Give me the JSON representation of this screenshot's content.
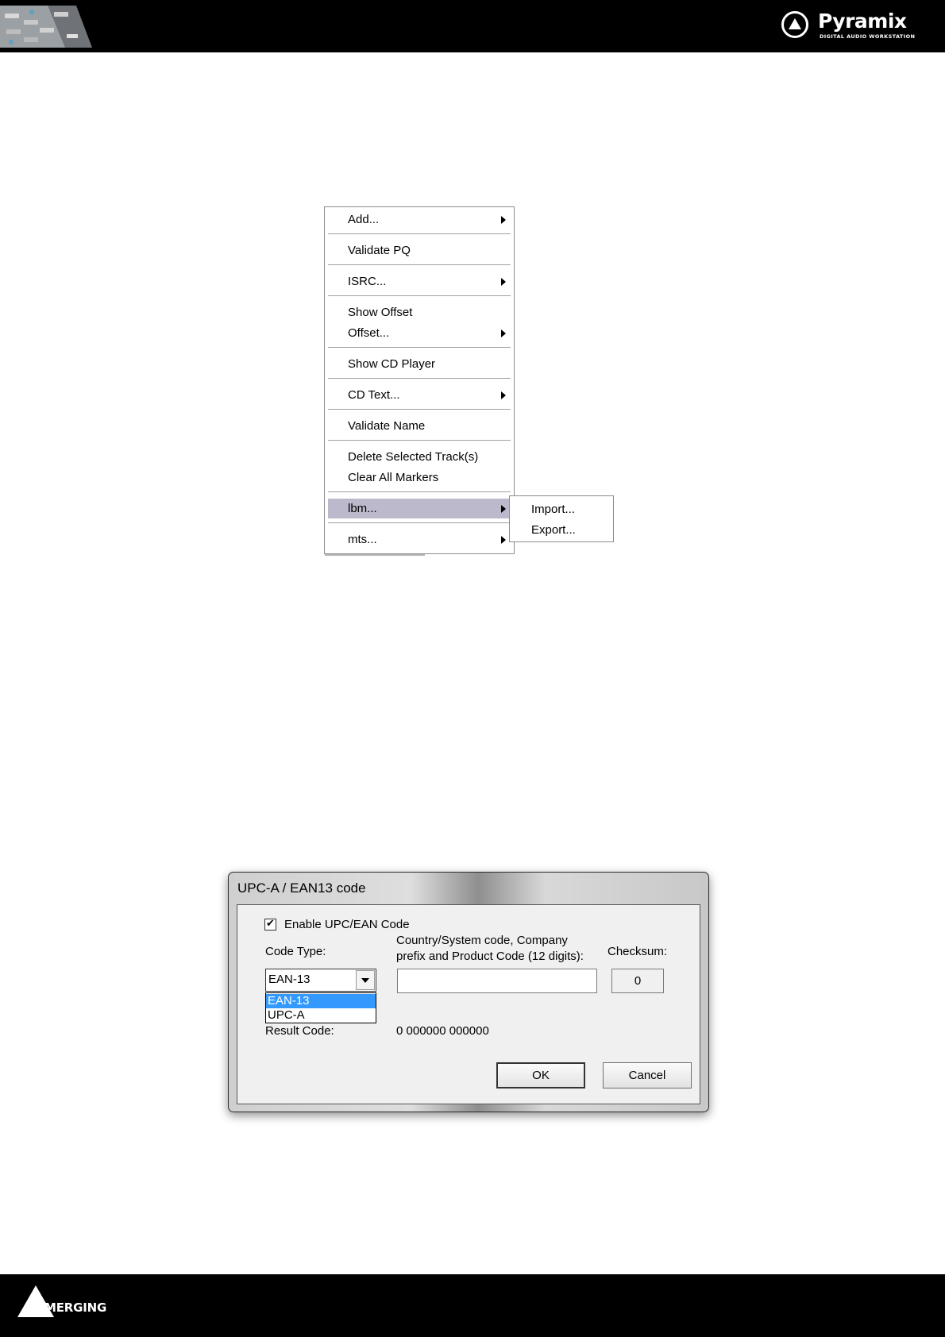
{
  "header": {
    "brand": {
      "name": "Pyramix",
      "subtitle": "DIGITAL AUDIO WORKSTATION"
    }
  },
  "context_menu": {
    "items": [
      {
        "label": "Add...",
        "submenu": true
      },
      {
        "label": "Validate PQ",
        "submenu": false
      },
      {
        "label": "ISRC...",
        "submenu": true
      },
      {
        "label": "Show Offset",
        "submenu": false
      },
      {
        "label": "Offset...",
        "submenu": true
      },
      {
        "label": "Show CD Player",
        "submenu": false
      },
      {
        "label": "CD Text...",
        "submenu": true
      },
      {
        "label": "Validate Name",
        "submenu": false
      },
      {
        "label": "Delete Selected Track(s)",
        "submenu": false
      },
      {
        "label": "Clear All Markers",
        "submenu": false
      },
      {
        "label": "lbm...",
        "submenu": true,
        "highlighted": true
      },
      {
        "label": "mts...",
        "submenu": true
      }
    ],
    "submenu_items": [
      {
        "label": "Import..."
      },
      {
        "label": "Export..."
      }
    ],
    "highlight_color": "#bcb9cc"
  },
  "dialog": {
    "title": "UPC-A / EAN13 code",
    "enable_checkbox": {
      "label": "Enable UPC/EAN Code",
      "checked": true,
      "mark": "✔"
    },
    "code_type": {
      "label": "Code Type:",
      "value": "EAN-13",
      "options": [
        "EAN-13",
        "UPC-A"
      ],
      "selected_option": "EAN-13"
    },
    "product_code": {
      "label_line1": "Country/System code, Company",
      "label_line2": "prefix and Product Code (12 digits):",
      "value": ""
    },
    "checksum": {
      "label": "Checksum:",
      "value": "0"
    },
    "result": {
      "label": "Result Code:",
      "value": "0 000000 000000"
    },
    "buttons": {
      "ok": "OK",
      "cancel": "Cancel"
    },
    "selection_color": "#3399ff"
  },
  "footer": {
    "brand": {
      "name": "MERGING"
    }
  }
}
